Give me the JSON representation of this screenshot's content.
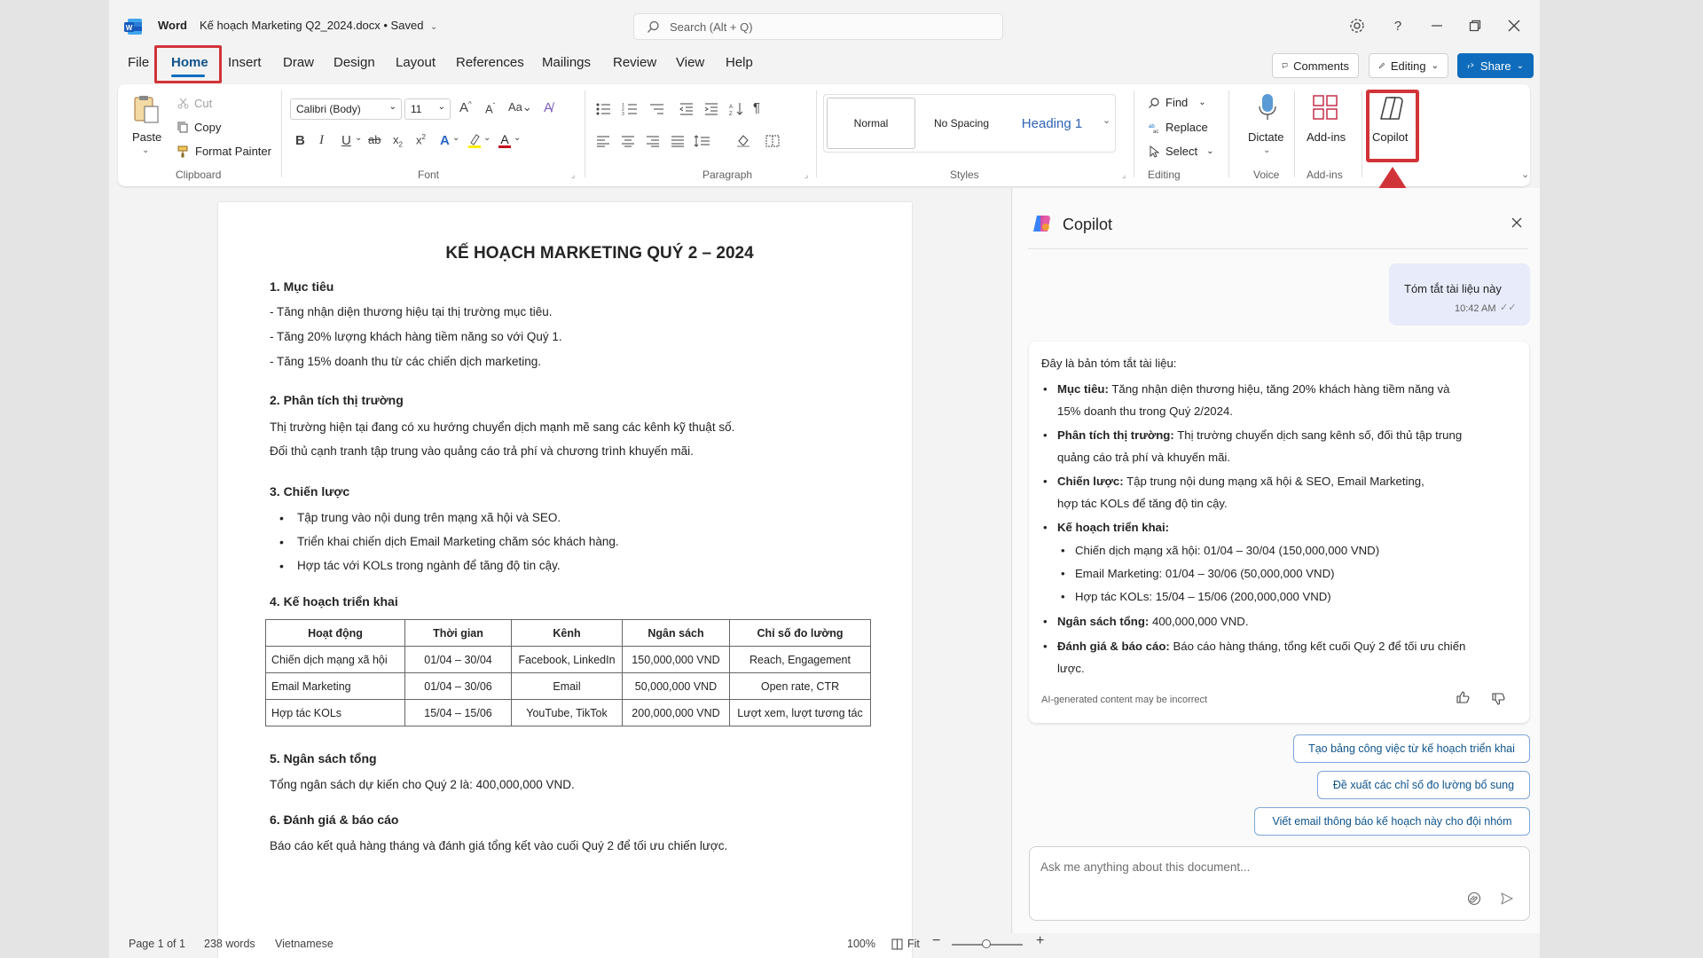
{
  "titlebar": {
    "app": "Word",
    "doc": "Kế hoạch Marketing Q2_2024.docx • Saved",
    "search_placeholder": "Search (Alt + Q)"
  },
  "menu": [
    "File",
    "Home",
    "Insert",
    "Draw",
    "Design",
    "Layout",
    "References",
    "Mailings",
    "Review",
    "View",
    "Help"
  ],
  "right_buttons": {
    "comments": "Comments",
    "editing": "Editing",
    "share": "Share"
  },
  "ribbon": {
    "clipboard": {
      "paste": "Paste",
      "cut": "Cut",
      "copy": "Copy",
      "format_painter": "Format Painter",
      "label": "Clipboard"
    },
    "font": {
      "family": "Calibri (Body)",
      "size": "11",
      "label": "Font"
    },
    "paragraph": {
      "label": "Paragraph"
    },
    "styles": {
      "normal": "Normal",
      "nospacing": "No Spacing",
      "heading1": "Heading 1",
      "label": "Styles"
    },
    "editing": {
      "find": "Find",
      "replace": "Replace",
      "select": "Select",
      "label": "Editing"
    },
    "voice": {
      "dictate": "Dictate",
      "label": "Voice"
    },
    "addins": {
      "btn": "Add-ins",
      "label": "Add-ins"
    },
    "copilot": "Copilot"
  },
  "document": {
    "title": "KẾ HOẠCH MARKETING QUÝ 2 – 2024",
    "s1": "1. Mục tiêu",
    "s1_lines": [
      "- Tăng nhận diện thương hiệu tại thị trường mục tiêu.",
      "- Tăng 20% lượng khách hàng tiềm năng so với Quý 1.",
      "- Tăng 15% doanh thu từ các chiến dịch marketing."
    ],
    "s2": "2. Phân tích thị trường",
    "s2_lines": [
      "Thị trường hiện tại đang có xu hướng chuyển dịch mạnh mẽ sang các kênh kỹ thuật số.",
      "Đối thủ cạnh tranh tập trung vào quảng cáo trả phí và chương trình khuyến mãi."
    ],
    "s3": "3. Chiến lược",
    "s3_bullets": [
      "Tập trung vào nội dung trên mạng xã hội và SEO.",
      "Triển khai chiến dịch Email Marketing chăm sóc khách hàng.",
      "Hợp tác với KOLs trong ngành để tăng độ tin cậy."
    ],
    "s4": "4. Kế hoạch triển khai",
    "table_headers": [
      "Hoạt động",
      "Thời gian",
      "Kênh",
      "Ngân sách",
      "Chỉ số đo lường"
    ],
    "table_rows": [
      [
        "Chiến dịch mạng xã hội",
        "01/04 – 30/04",
        "Facebook, LinkedIn",
        "150,000,000 VND",
        "Reach, Engagement"
      ],
      [
        "Email Marketing",
        "01/04 – 30/06",
        "Email",
        "50,000,000 VND",
        "Open rate, CTR"
      ],
      [
        "Hợp tác KOLs",
        "15/04 – 15/06",
        "YouTube, TikTok",
        "200,000,000 VND",
        "Lượt xem, lượt tương tác"
      ]
    ],
    "s5": "5. Ngân sách tổng",
    "s5_line": "Tổng ngân sách dự kiến cho Quý 2 là: 400,000,000 VND.",
    "s6": "6. Đánh giá & báo cáo",
    "s6_line": "Báo cáo kết quả hàng tháng và đánh giá tổng kết vào cuối Quý 2 để tối ưu chiến lược."
  },
  "statusbar": {
    "page": "Page 1 of 1",
    "words": "238 words",
    "lang": "Vietnamese",
    "zoom": "100%",
    "fit": "Fit"
  },
  "copilot": {
    "title": "Copilot",
    "user_msg": "Tóm tắt tài liệu này",
    "user_time": "10:42 AM",
    "intro": "Đây là bản tóm tắt tài liệu:",
    "b1_label": "Mục tiêu:",
    "b1_text1": "Tăng nhận diện thương hiệu, tăng 20% khách hàng tiềm năng và",
    "b1_text2": "15% doanh thu trong Quý 2/2024.",
    "b2_label": "Phân tích thị trường:",
    "b2_text1": "Thị trường chuyển dịch sang kênh số, đối thủ tập trung",
    "b2_text2": "quảng cáo trả phí và khuyến mãi.",
    "b3_label": "Chiến lược:",
    "b3_text1": "Tập trung nội dung mạng xã hội & SEO, Email Marketing,",
    "b3_text2": "hợp tác KOLs để tăng độ tin cậy.",
    "b4_label": "Kế hoạch triển khai:",
    "b4_sub": [
      "Chiến dịch mạng xã hội: 01/04 – 30/04 (150,000,000 VND)",
      "Email Marketing: 01/04 – 30/06 (50,000,000 VND)",
      "Hợp tác KOLs: 15/04 – 15/06 (200,000,000 VND)"
    ],
    "b5_label": "Ngân sách tổng:",
    "b5_text": "400,000,000 VND.",
    "b6_label": "Đánh giá & báo cáo:",
    "b6_text1": "Báo cáo hàng tháng, tổng kết cuối Quý 2 để tối ưu chiến",
    "b6_text2": "lược.",
    "disclaimer": "AI-generated content may be incorrect",
    "suggestions": [
      "Tạo bảng công việc từ kế hoạch triển khai",
      "Đề xuất các chỉ số đo lường bổ sung",
      "Viết email thông báo kế hoạch này cho đội nhóm"
    ],
    "ask_placeholder": "Ask me anything about this document..."
  }
}
